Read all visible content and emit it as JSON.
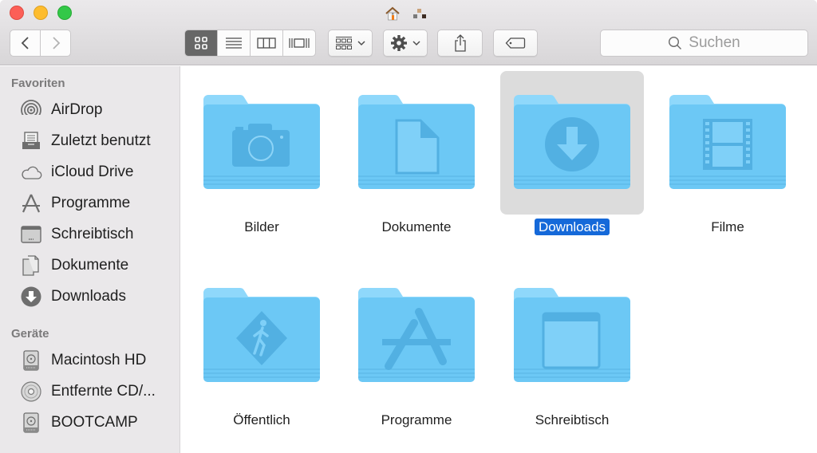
{
  "window": {
    "title_icons": [
      "home-icon",
      "network-icon"
    ],
    "traffic_lights": [
      "close",
      "minimize",
      "maximize"
    ]
  },
  "toolbar": {
    "back_icon": "chevron-left-icon",
    "forward_icon": "chevron-right-icon",
    "view_modes": [
      {
        "name": "icon-view",
        "icon": "grid-icon",
        "active": true
      },
      {
        "name": "list-view",
        "icon": "list-icon",
        "active": false
      },
      {
        "name": "column-view",
        "icon": "columns-icon",
        "active": false
      },
      {
        "name": "cover-flow-view",
        "icon": "cover-flow-icon",
        "active": false
      }
    ],
    "arrange_icon": "arrange-grid-icon",
    "action_icon": "gear-icon",
    "share_icon": "share-icon",
    "tag_icon": "tag-icon",
    "search_placeholder": "Suchen"
  },
  "sidebar": {
    "favorites_title": "Favoriten",
    "favorites": [
      {
        "label": "AirDrop",
        "icon": "airdrop-icon"
      },
      {
        "label": "Zuletzt benutzt",
        "icon": "recents-icon"
      },
      {
        "label": "iCloud Drive",
        "icon": "cloud-icon"
      },
      {
        "label": "Programme",
        "icon": "applications-icon"
      },
      {
        "label": "Schreibtisch",
        "icon": "desktop-icon"
      },
      {
        "label": "Dokumente",
        "icon": "documents-icon"
      },
      {
        "label": "Downloads",
        "icon": "downloads-icon"
      }
    ],
    "devices_title": "Geräte",
    "devices": [
      {
        "label": "Macintosh HD",
        "icon": "hard-drive-icon"
      },
      {
        "label": "Entfernte CD/...",
        "icon": "disc-icon"
      },
      {
        "label": "BOOTCAMP",
        "icon": "hard-drive-icon"
      }
    ]
  },
  "content": {
    "folders": [
      {
        "label": "Bilder",
        "emblem": "camera-icon",
        "selected": false
      },
      {
        "label": "Dokumente",
        "emblem": "document-icon",
        "selected": false
      },
      {
        "label": "Downloads",
        "emblem": "download-icon",
        "selected": true
      },
      {
        "label": "Filme",
        "emblem": "film-icon",
        "selected": false
      },
      {
        "label": "Öffentlich",
        "emblem": "public-icon",
        "selected": false
      },
      {
        "label": "Programme",
        "emblem": "applications-icon",
        "selected": false
      },
      {
        "label": "Schreibtisch",
        "emblem": "desktop-icon",
        "selected": false
      }
    ]
  },
  "colors": {
    "folder_front": "#6cc8f5",
    "folder_back": "#8fd8fb",
    "selection": "#1569d9",
    "selection_bg": "#dcdcdc"
  }
}
